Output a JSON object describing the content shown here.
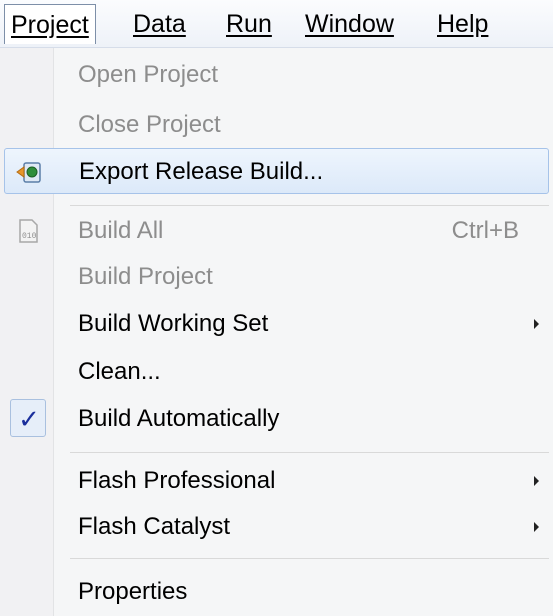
{
  "menubar": {
    "items": [
      {
        "label": "Project"
      },
      {
        "label": "Data"
      },
      {
        "label": "Run"
      },
      {
        "label": "Window"
      },
      {
        "label": "Help"
      }
    ]
  },
  "menu": {
    "open_project": "Open Project",
    "close_project": "Close Project",
    "export_release_build": "Export Release Build...",
    "build_all": "Build All",
    "build_all_shortcut": "Ctrl+B",
    "build_project": "Build Project",
    "build_working_set": "Build Working Set",
    "clean": "Clean...",
    "build_automatically": "Build Automatically",
    "build_automatically_checked": true,
    "flash_professional": "Flash Professional",
    "flash_catalyst": "Flash Catalyst",
    "properties": "Properties"
  },
  "icons": {
    "export_release_build": "export-build-icon",
    "build_all": "binary-file-icon",
    "checkmark": "check-icon",
    "submenu": "chevron-right-icon"
  },
  "colors": {
    "highlight_border": "#a6c3e9",
    "disabled_text": "#8d8d8d",
    "checkmark": "#1a2f9c"
  }
}
